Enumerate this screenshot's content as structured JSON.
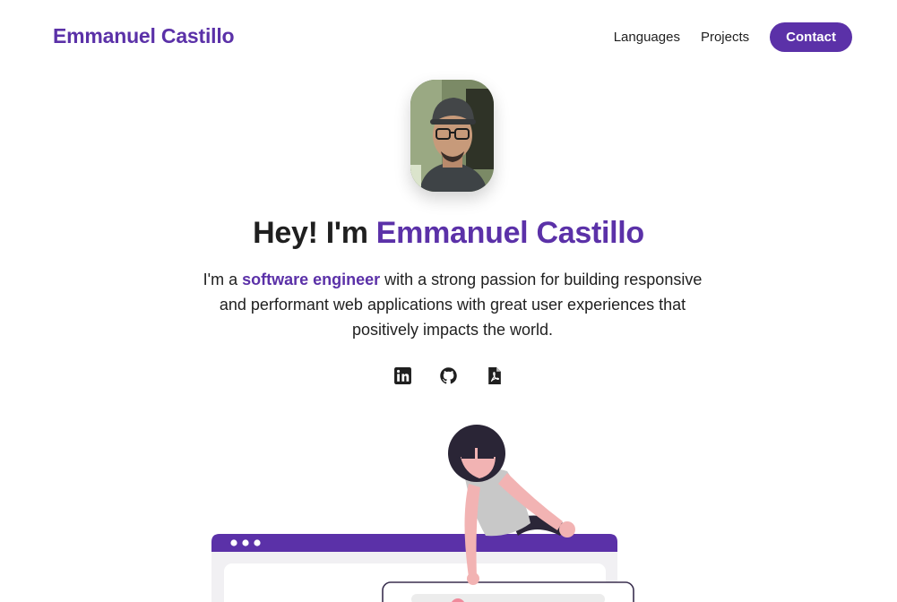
{
  "header": {
    "brand": "Emmanuel Castillo",
    "nav": {
      "languages": "Languages",
      "projects": "Projects",
      "contact": "Contact"
    }
  },
  "hero": {
    "title_prefix": "Hey! I'm ",
    "title_name": "Emmanuel Castillo",
    "intro_prefix": "I'm a ",
    "intro_accent": "software engineer",
    "intro_rest": " with a strong passion for building responsive and performant web applications with great user experiences that positively impacts the world."
  },
  "socials": [
    {
      "icon": "linkedin-icon"
    },
    {
      "icon": "github-icon"
    },
    {
      "icon": "pdf-resume-icon"
    }
  ],
  "colors": {
    "accent": "#5b31a8",
    "text": "#1f1f1f",
    "background": "#ffffff"
  }
}
